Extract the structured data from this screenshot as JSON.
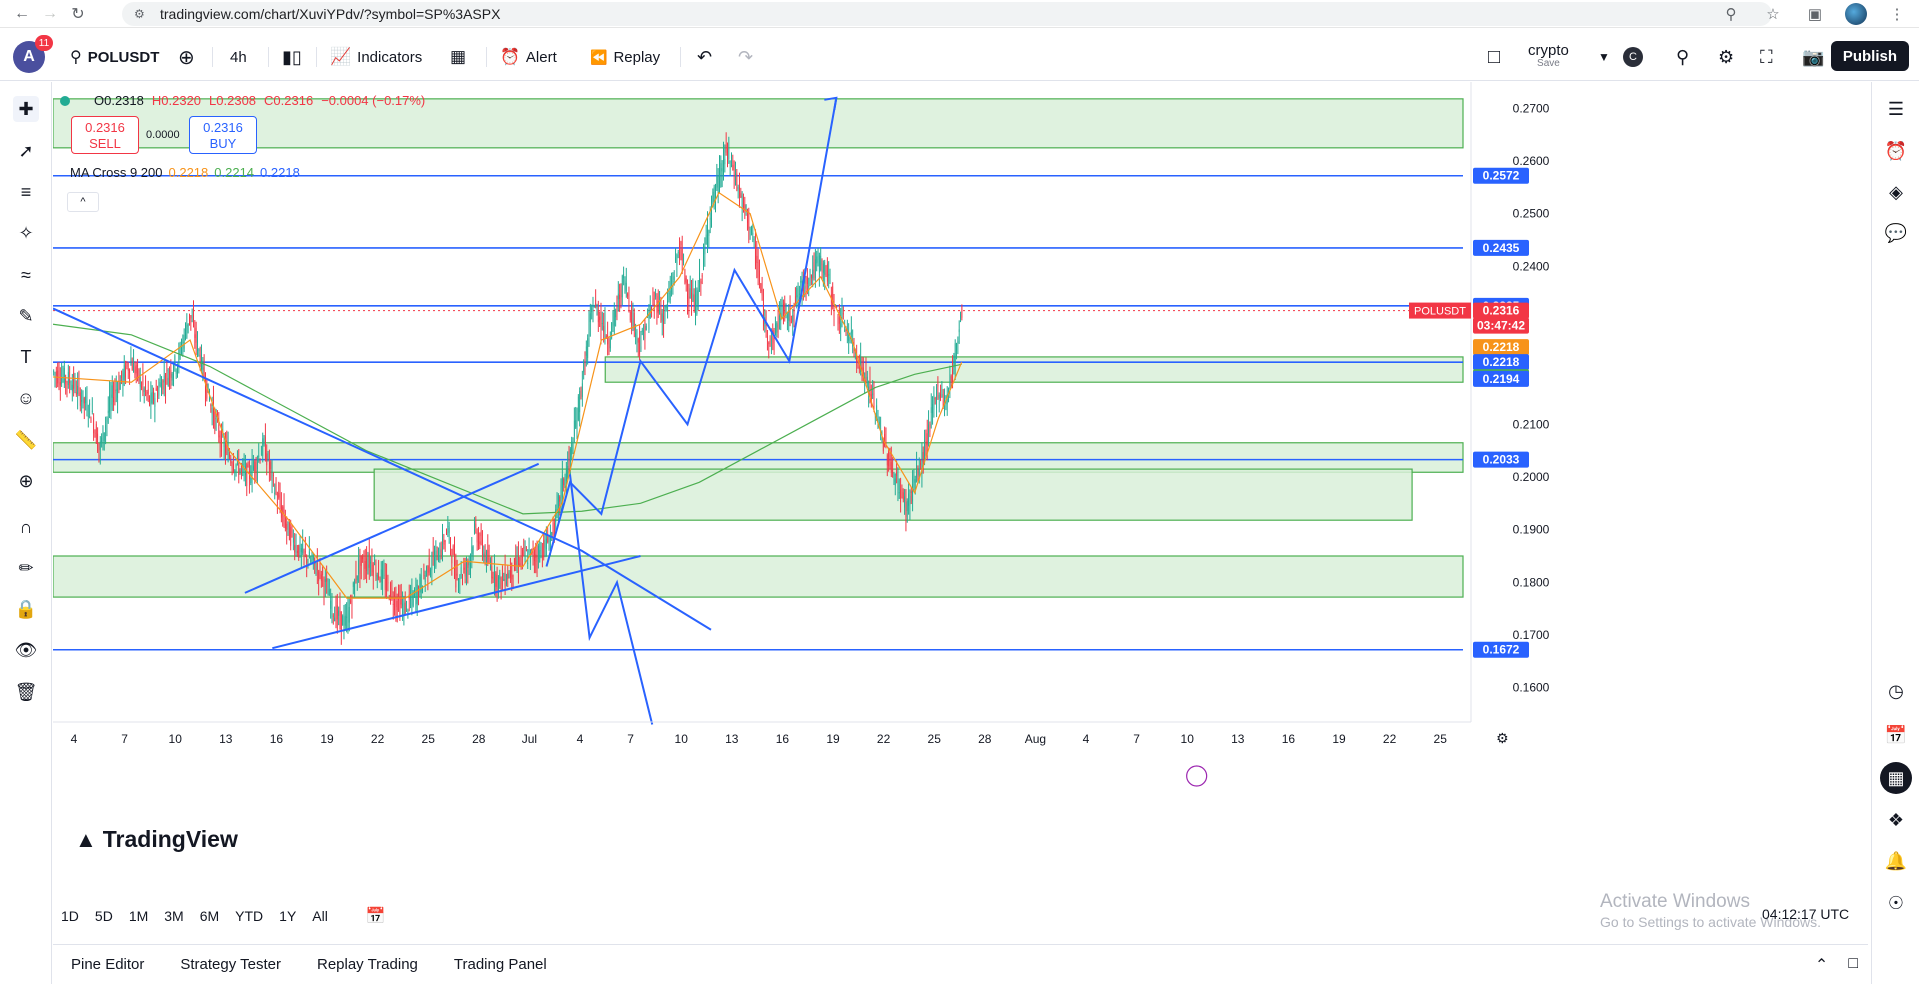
{
  "browser": {
    "url": "tradingview.com/chart/XuviYPdv/?symbol=SP%3ASPX"
  },
  "toolbar": {
    "avatar_letter": "A",
    "notification_count": "11",
    "symbol": "POLUSDT",
    "interval": "4h",
    "indicators_label": "Indicators",
    "alert_label": "Alert",
    "replay_label": "Replay",
    "layout_name": "crypto",
    "layout_sub": "Save",
    "layout_badge": "C",
    "publish_label": "Publish"
  },
  "legend": {
    "open": "O0.2318",
    "high": "H0.2320",
    "low": "L0.2308",
    "close": "C0.2316",
    "change": "−0.0004 (−0.17%)",
    "sell_price": "0.2316",
    "sell_label": "SELL",
    "spread": "0.0000",
    "buy_price": "0.2316",
    "buy_label": "BUY",
    "ma_name": "MA Cross 9 200",
    "ma_v1": "0.2218",
    "ma_v2": "0.2214",
    "ma_v3": "0.2218",
    "collapse": "^"
  },
  "branding": {
    "logo_text": "TradingView"
  },
  "footer": {
    "watermark_title": "Activate Windows",
    "watermark_sub": "Go to Settings to activate Windows.",
    "clock": "04:12:17 UTC",
    "ranges": [
      "1D",
      "5D",
      "1M",
      "3M",
      "6M",
      "YTD",
      "1Y",
      "All"
    ],
    "tabs": [
      "Pine Editor",
      "Strategy Tester",
      "Replay Trading",
      "Trading Panel"
    ]
  },
  "colors": {
    "up": "#22ab94",
    "down": "#f23645",
    "line_blue": "#2962ff",
    "zone_fill": "#d9f0d9",
    "zone_border": "#4caf50",
    "ma_fast": "#f7931a",
    "ma_slow": "#4caf50"
  },
  "chart_data": {
    "type": "candlestick",
    "symbol": "POLUSDT",
    "interval": "4h",
    "y_range": [
      0.155,
      0.275
    ],
    "y_ticks": [
      "0.2700",
      "0.2600",
      "0.2500",
      "0.2400",
      "0.2100",
      "0.2000",
      "0.1900",
      "0.1800",
      "0.1700",
      "0.1600"
    ],
    "x_ticks": [
      "4",
      "7",
      "10",
      "13",
      "16",
      "19",
      "22",
      "25",
      "28",
      "Jul",
      "4",
      "7",
      "10",
      "13",
      "16",
      "19",
      "22",
      "25",
      "28",
      "Aug",
      "4",
      "7",
      "10",
      "13",
      "16",
      "19",
      "22",
      "25"
    ],
    "price_labels": [
      {
        "value": "0.2572",
        "color": "#2962ff"
      },
      {
        "value": "0.2435",
        "color": "#2962ff"
      },
      {
        "value": "0.2325",
        "color": "#2962ff"
      },
      {
        "value": "0.2316",
        "color": "#f23645"
      },
      {
        "value": "03:47:42",
        "color": "#f23645"
      },
      {
        "value": "0.2218",
        "color": "#f7931a"
      },
      {
        "value": "0.2218",
        "color": "#2962ff"
      },
      {
        "value": "0.2214",
        "color": "#4caf50"
      },
      {
        "value": "0.2194",
        "color": "#2962ff"
      },
      {
        "value": "0.2033",
        "color": "#2962ff"
      },
      {
        "value": "0.1672",
        "color": "#2962ff"
      }
    ],
    "symbol_tag": "POLUSDT",
    "horizontal_lines": [
      0.2572,
      0.2435,
      0.2325,
      0.2218,
      0.2033,
      0.1672
    ],
    "zones": [
      {
        "top": 0.2718,
        "bottom": 0.2625
      },
      {
        "top": 0.2228,
        "bottom": 0.218
      },
      {
        "top": 0.2065,
        "bottom": 0.2009
      },
      {
        "top": 0.2015,
        "bottom": 0.1918
      },
      {
        "top": 0.185,
        "bottom": 0.1772
      }
    ],
    "price_path": [
      [
        0,
        0.22
      ],
      [
        5,
        0.218
      ],
      [
        10,
        0.212
      ],
      [
        12,
        0.205
      ],
      [
        15,
        0.215
      ],
      [
        20,
        0.222
      ],
      [
        25,
        0.214
      ],
      [
        28,
        0.218
      ],
      [
        32,
        0.222
      ],
      [
        35,
        0.231
      ],
      [
        37,
        0.225
      ],
      [
        40,
        0.215
      ],
      [
        43,
        0.207
      ],
      [
        46,
        0.203
      ],
      [
        50,
        0.2
      ],
      [
        54,
        0.206
      ],
      [
        57,
        0.197
      ],
      [
        60,
        0.19
      ],
      [
        63,
        0.186
      ],
      [
        66,
        0.184
      ],
      [
        69,
        0.181
      ],
      [
        72,
        0.174
      ],
      [
        75,
        0.172
      ],
      [
        78,
        0.183
      ],
      [
        81,
        0.184
      ],
      [
        84,
        0.181
      ],
      [
        87,
        0.177
      ],
      [
        90,
        0.175
      ],
      [
        93,
        0.178
      ],
      [
        96,
        0.183
      ],
      [
        99,
        0.186
      ],
      [
        101,
        0.19
      ],
      [
        103,
        0.181
      ],
      [
        106,
        0.183
      ],
      [
        108,
        0.19
      ],
      [
        111,
        0.184
      ],
      [
        114,
        0.18
      ],
      [
        117,
        0.182
      ],
      [
        120,
        0.185
      ],
      [
        123,
        0.185
      ],
      [
        126,
        0.187
      ],
      [
        128,
        0.19
      ],
      [
        130,
        0.198
      ],
      [
        132,
        0.203
      ],
      [
        134,
        0.212
      ],
      [
        136,
        0.222
      ],
      [
        138,
        0.233
      ],
      [
        140,
        0.23
      ],
      [
        142,
        0.226
      ],
      [
        144,
        0.232
      ],
      [
        146,
        0.238
      ],
      [
        148,
        0.23
      ],
      [
        150,
        0.225
      ],
      [
        152,
        0.23
      ],
      [
        154,
        0.234
      ],
      [
        156,
        0.23
      ],
      [
        158,
        0.236
      ],
      [
        160,
        0.244
      ],
      [
        162,
        0.236
      ],
      [
        164,
        0.232
      ],
      [
        166,
        0.24
      ],
      [
        168,
        0.251
      ],
      [
        170,
        0.256
      ],
      [
        172,
        0.262
      ],
      [
        174,
        0.258
      ],
      [
        176,
        0.252
      ],
      [
        178,
        0.248
      ],
      [
        180,
        0.24
      ],
      [
        182,
        0.228
      ],
      [
        184,
        0.226
      ],
      [
        186,
        0.232
      ],
      [
        188,
        0.23
      ],
      [
        190,
        0.234
      ],
      [
        192,
        0.237
      ],
      [
        194,
        0.239
      ],
      [
        196,
        0.241
      ],
      [
        198,
        0.238
      ],
      [
        200,
        0.231
      ],
      [
        202,
        0.229
      ],
      [
        204,
        0.226
      ],
      [
        206,
        0.222
      ],
      [
        208,
        0.218
      ],
      [
        210,
        0.213
      ],
      [
        212,
        0.207
      ],
      [
        214,
        0.202
      ],
      [
        216,
        0.198
      ],
      [
        218,
        0.194
      ],
      [
        220,
        0.199
      ],
      [
        222,
        0.203
      ],
      [
        224,
        0.21
      ],
      [
        226,
        0.217
      ],
      [
        228,
        0.214
      ],
      [
        230,
        0.221
      ],
      [
        232,
        0.2316
      ]
    ],
    "ma_fast": [
      [
        0,
        0.219
      ],
      [
        20,
        0.218
      ],
      [
        35,
        0.226
      ],
      [
        45,
        0.205
      ],
      [
        60,
        0.192
      ],
      [
        75,
        0.177
      ],
      [
        90,
        0.177
      ],
      [
        105,
        0.184
      ],
      [
        120,
        0.183
      ],
      [
        130,
        0.195
      ],
      [
        140,
        0.226
      ],
      [
        150,
        0.229
      ],
      [
        160,
        0.238
      ],
      [
        170,
        0.254
      ],
      [
        178,
        0.25
      ],
      [
        186,
        0.23
      ],
      [
        196,
        0.238
      ],
      [
        204,
        0.226
      ],
      [
        212,
        0.207
      ],
      [
        220,
        0.197
      ],
      [
        226,
        0.211
      ],
      [
        232,
        0.2218
      ]
    ],
    "ma_slow": [
      [
        0,
        0.229
      ],
      [
        20,
        0.227
      ],
      [
        40,
        0.221
      ],
      [
        60,
        0.213
      ],
      [
        80,
        0.205
      ],
      [
        100,
        0.199
      ],
      [
        120,
        0.193
      ],
      [
        135,
        0.1935
      ],
      [
        150,
        0.195
      ],
      [
        165,
        0.199
      ],
      [
        180,
        0.205
      ],
      [
        195,
        0.211
      ],
      [
        210,
        0.217
      ],
      [
        220,
        0.2195
      ],
      [
        232,
        0.2214
      ]
    ],
    "drawn_lines": [
      [
        [
          0,
          0.232
        ],
        [
          135,
          0.186
        ],
        [
          168,
          0.171
        ]
      ],
      [
        [
          49,
          0.178
        ],
        [
          124,
          0.2025
        ]
      ],
      [
        [
          56,
          0.1675
        ],
        [
          150,
          0.185
        ]
      ],
      [
        [
          126,
          0.183
        ],
        [
          132,
          0.199
        ],
        [
          140,
          0.193
        ],
        [
          150,
          0.222
        ],
        [
          162,
          0.21
        ],
        [
          174,
          0.2393
        ],
        [
          188,
          0.222
        ],
        [
          200,
          0.272
        ]
      ],
      [
        [
          132,
          0.2005
        ],
        [
          137,
          0.1695
        ],
        [
          144,
          0.18
        ],
        [
          153,
          0.153
        ]
      ]
    ]
  }
}
